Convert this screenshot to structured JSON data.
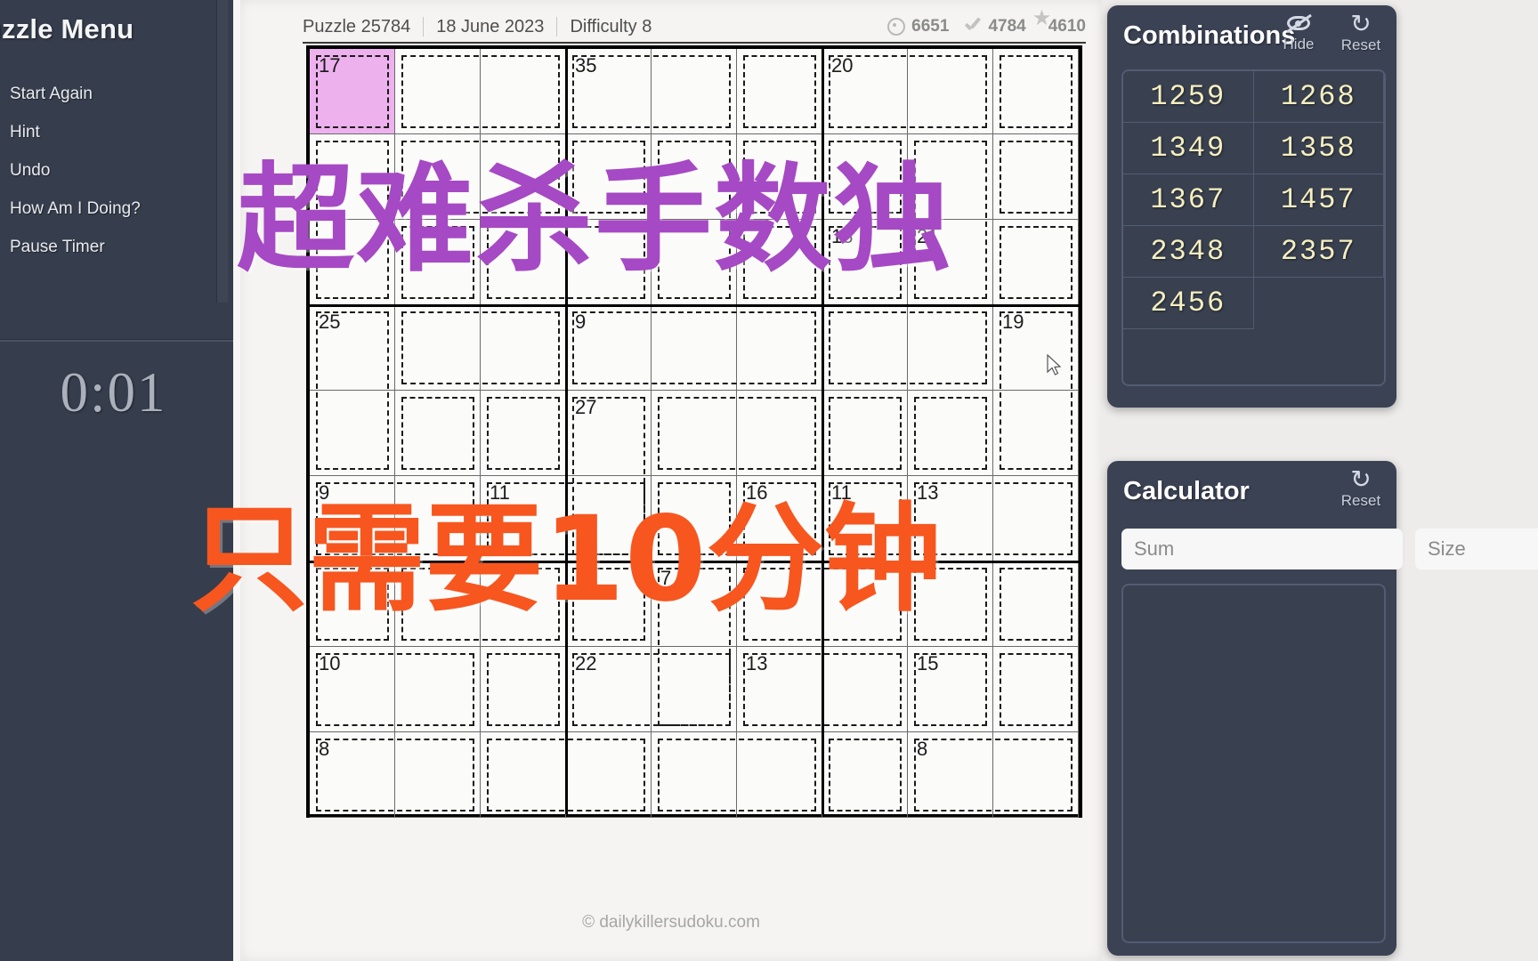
{
  "sidebar": {
    "title": "Puzzle Menu",
    "items": [
      {
        "label": "Start Again",
        "name": "start-again"
      },
      {
        "label": "Hint",
        "name": "hint"
      },
      {
        "label": "Undo",
        "name": "undo"
      },
      {
        "label": "How Am I Doing?",
        "name": "how-am-i-doing"
      },
      {
        "label": "Pause Timer",
        "name": "pause-timer"
      }
    ],
    "timer": "0:01"
  },
  "header": {
    "puzzle": "Puzzle 25784",
    "date": "18 June 2023",
    "difficulty": "Difficulty 8",
    "stats": [
      {
        "icon": "target-icon",
        "value": "6651"
      },
      {
        "icon": "check-icon",
        "value": "4784"
      },
      {
        "icon": "star-icon",
        "value": "4610"
      }
    ]
  },
  "combinations_panel": {
    "title": "Combinations",
    "hide_label": "Hide",
    "reset_label": "Reset",
    "hide_icon": "eye-slash-icon",
    "reset_icon": "refresh-icon",
    "values": [
      "1259",
      "1268",
      "1349",
      "1358",
      "1367",
      "1457",
      "2348",
      "2357",
      "2456"
    ]
  },
  "calculator_panel": {
    "title": "Calculator",
    "reset_label": "Reset",
    "reset_icon": "refresh-icon",
    "sum_placeholder": "Sum",
    "size_placeholder": "Size",
    "sum_value": "",
    "size_value": ""
  },
  "grid": {
    "selected_cell": {
      "row": 0,
      "col": 0
    },
    "selected_color": "#edb1ee",
    "cage_sums": [
      {
        "sum": "17",
        "row": 0,
        "col": 0
      },
      {
        "sum": "35",
        "row": 0,
        "col": 3
      },
      {
        "sum": "20",
        "row": 0,
        "col": 6
      },
      {
        "sum": "18",
        "row": 2,
        "col": 6
      },
      {
        "sum": "21",
        "row": 2,
        "col": 7
      },
      {
        "sum": "25",
        "row": 3,
        "col": 0
      },
      {
        "sum": "9",
        "row": 3,
        "col": 3
      },
      {
        "sum": "19",
        "row": 3,
        "col": 8
      },
      {
        "sum": "27",
        "row": 4,
        "col": 3
      },
      {
        "sum": "9",
        "row": 5,
        "col": 0
      },
      {
        "sum": "11",
        "row": 5,
        "col": 2
      },
      {
        "sum": "16",
        "row": 5,
        "col": 5
      },
      {
        "sum": "11",
        "row": 5,
        "col": 6
      },
      {
        "sum": "13",
        "row": 5,
        "col": 7
      },
      {
        "sum": "7",
        "row": 6,
        "col": 4
      },
      {
        "sum": "10",
        "row": 7,
        "col": 0
      },
      {
        "sum": "22",
        "row": 7,
        "col": 3
      },
      {
        "sum": "13",
        "row": 7,
        "col": 5
      },
      {
        "sum": "15",
        "row": 7,
        "col": 7
      },
      {
        "sum": "8",
        "row": 8,
        "col": 0
      },
      {
        "sum": "8",
        "row": 8,
        "col": 7
      }
    ]
  },
  "footer": {
    "credit": "© dailykillersudoku.com"
  },
  "overlay": {
    "purple_text": "超难杀手数独",
    "purple_color": "#a649c4",
    "orange_text": "只需要10分钟",
    "orange_color": "#f7561f"
  }
}
